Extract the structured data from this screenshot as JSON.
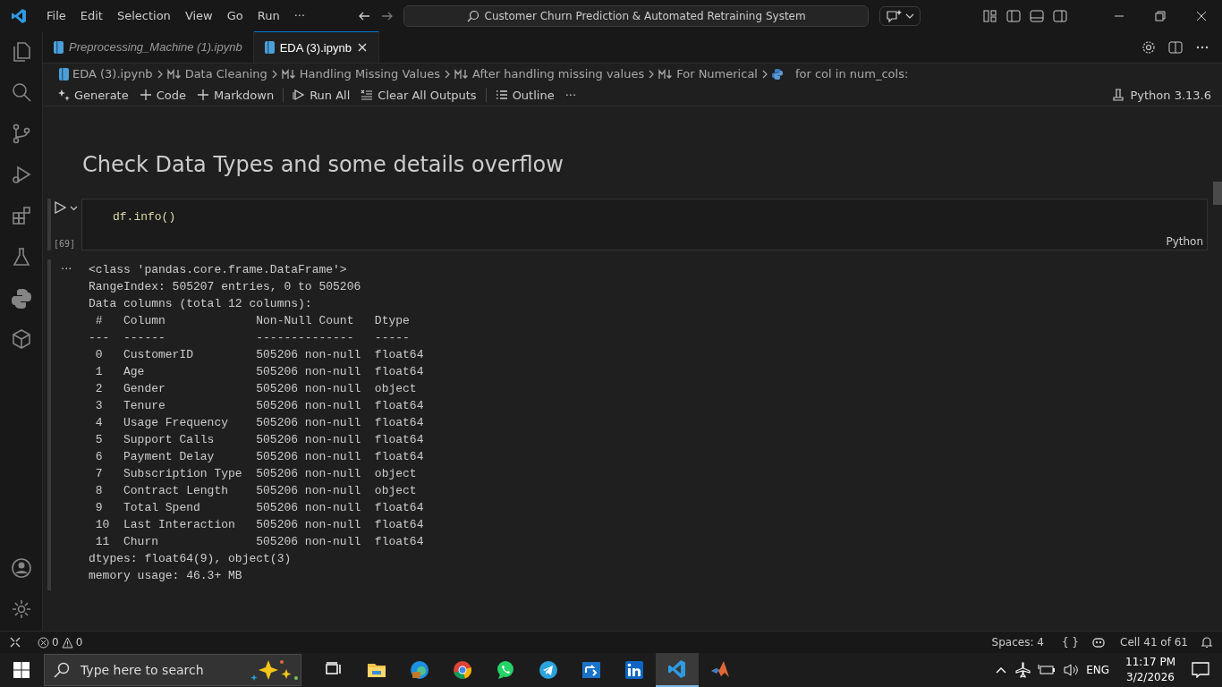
{
  "title_bar": {
    "menu": [
      "File",
      "Edit",
      "Selection",
      "View",
      "Go",
      "Run",
      "···"
    ],
    "search": "Customer Churn Prediction & Automated Retraining System"
  },
  "tabs": [
    {
      "label": "Preprocessing_Machine (1).ipynb",
      "selected": false
    },
    {
      "label": "EDA (3).ipynb",
      "selected": true
    }
  ],
  "breadcrumb": [
    {
      "kind": "file",
      "label": "EDA (3).ipynb"
    },
    {
      "kind": "markdown",
      "label": "Data Cleaning"
    },
    {
      "kind": "markdown",
      "label": "Handling Missing Values"
    },
    {
      "kind": "markdown",
      "label": "After handling missing values"
    },
    {
      "kind": "markdown",
      "label": "For Numerical"
    },
    {
      "kind": "code",
      "label": "for col in num_cols:"
    }
  ],
  "toolbar": [
    {
      "kind": "generate",
      "label": "Generate"
    },
    {
      "kind": "add",
      "label": "Code"
    },
    {
      "kind": "add",
      "label": "Markdown"
    },
    {
      "kind": "run",
      "label": "Run All"
    },
    {
      "kind": "clear",
      "label": "Clear All Outputs"
    },
    {
      "kind": "outline",
      "label": "Outline"
    },
    {
      "kind": "more",
      "label": "···"
    }
  ],
  "kernel": "Python 3.13.6",
  "notebook": {
    "heading": "Check Data Types and some details overflow",
    "cell": {
      "code": "df.info()",
      "execution_count": "[69]",
      "language": "Python"
    },
    "output_menu": "···",
    "output": [
      "<class 'pandas.core.frame.DataFrame'>",
      "RangeIndex: 505207 entries, 0 to 505206",
      "Data columns (total 12 columns):",
      " #   Column             Non-Null Count   Dtype  ",
      "---  ------             --------------   -----  ",
      " 0   CustomerID         505206 non-null  float64",
      " 1   Age                505206 non-null  float64",
      " 2   Gender             505206 non-null  object ",
      " 3   Tenure             505206 non-null  float64",
      " 4   Usage Frequency    505206 non-null  float64",
      " 5   Support Calls      505206 non-null  float64",
      " 6   Payment Delay      505206 non-null  float64",
      " 7   Subscription Type  505206 non-null  object ",
      " 8   Contract Length    505206 non-null  object ",
      " 9   Total Spend        505206 non-null  float64",
      " 10  Last Interaction   505206 non-null  float64",
      " 11  Churn              505206 non-null  float64",
      "dtypes: float64(9), object(3)",
      "memory usage: 46.3+ MB"
    ]
  },
  "status_bar": {
    "errors": "0",
    "warnings": "0",
    "spaces": "Spaces: 4",
    "braces": "{ }",
    "cell": "Cell 41 of 61"
  },
  "taskbar": {
    "search_placeholder": "Type here to search",
    "language": "ENG",
    "time": "11:17 PM",
    "date": "3/2/2026"
  }
}
